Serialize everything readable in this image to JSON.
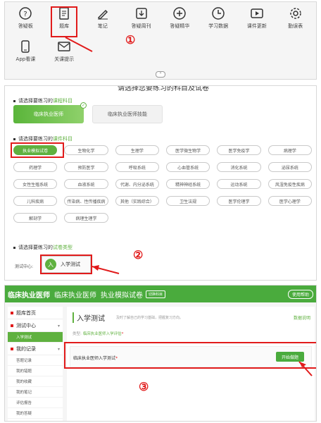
{
  "panel1": {
    "tools": [
      {
        "icon": "question-circle-icon",
        "label": "答疑板"
      },
      {
        "icon": "question-bank-icon",
        "label": "题库"
      },
      {
        "icon": "pen-note-icon",
        "label": "笔记"
      },
      {
        "icon": "download-icon",
        "label": "答疑周刊"
      },
      {
        "icon": "plus-circle-icon",
        "label": "答疑精华"
      },
      {
        "icon": "clock-icon",
        "label": "学习数据"
      },
      {
        "icon": "video-icon",
        "label": "课件更新"
      },
      {
        "icon": "gear-icon",
        "label": "勤误表"
      },
      {
        "icon": "phone-icon",
        "label": "App看课"
      },
      {
        "icon": "mail-icon",
        "label": "关课提示"
      }
    ],
    "step_marker": "①"
  },
  "panel2": {
    "cut_title": "请选择您要练习的科目及试卷",
    "section1_prefix": "请选择要练习的",
    "section1_highlight": "课程科目",
    "subjects": [
      "临床执业医师",
      "临床执业医师技能"
    ],
    "section2_prefix": "请选择要练习的",
    "section2_highlight": "课件科目",
    "chapters": [
      "执业模拟试卷",
      "生物化学",
      "生理学",
      "医学微生物学",
      "医学免疫学",
      "病理学",
      "药理学",
      "预防医学",
      "呼吸系统",
      "心血管系统",
      "消化系统",
      "泌尿系统",
      "女性生殖系统",
      "血液系统",
      "代谢、内分泌系统",
      "精神神经系统",
      "运动系统",
      "风湿免疫性疾病",
      "儿科疾病",
      "传染病、性传播疾病",
      "其他（实践综合）",
      "卫生法规",
      "医学伦理学",
      "医学心理学",
      "解剖学",
      "病理生理学"
    ],
    "section3_prefix": "请选择要练习的",
    "section3_highlight": "试卷类型",
    "test_center_label": "测试中心:",
    "test_avatar": "入",
    "test_name": "入学测试",
    "step_marker": "②"
  },
  "panel3": {
    "header_title": "临床执业医师",
    "header_sub1": "临床执业医师",
    "header_sub2": "执业模拟试卷",
    "switch_label": "切换科目",
    "help_label": "使用帮助",
    "sidebar": [
      {
        "type": "group",
        "label": "题库首页"
      },
      {
        "type": "group",
        "label": "测试中心",
        "arrow": "▾"
      },
      {
        "type": "item",
        "label": "入学测试",
        "active": true
      },
      {
        "type": "group",
        "label": "我的记录",
        "arrow": "▾"
      },
      {
        "type": "item",
        "label": "答题记录"
      },
      {
        "type": "item",
        "label": "我的错题"
      },
      {
        "type": "item",
        "label": "我的收藏"
      },
      {
        "type": "item",
        "label": "我的笔记"
      },
      {
        "type": "item",
        "label": "评估报告"
      },
      {
        "type": "item",
        "label": "我的答疑"
      }
    ],
    "main_title": "入学测试",
    "main_desc": "及时了解自己的学习基础，把握复习方向。",
    "stat_link": "数据说明",
    "type_prefix": "类型:",
    "type_value": "临床执业医师入学评估",
    "row_name": "临床执业医师入学测试",
    "start_button": "开始做题",
    "step_marker": "③"
  },
  "colors": {
    "accent_green": "#5fb13f",
    "header_green": "#4aab3d",
    "annotation_red": "#e11b1b"
  }
}
